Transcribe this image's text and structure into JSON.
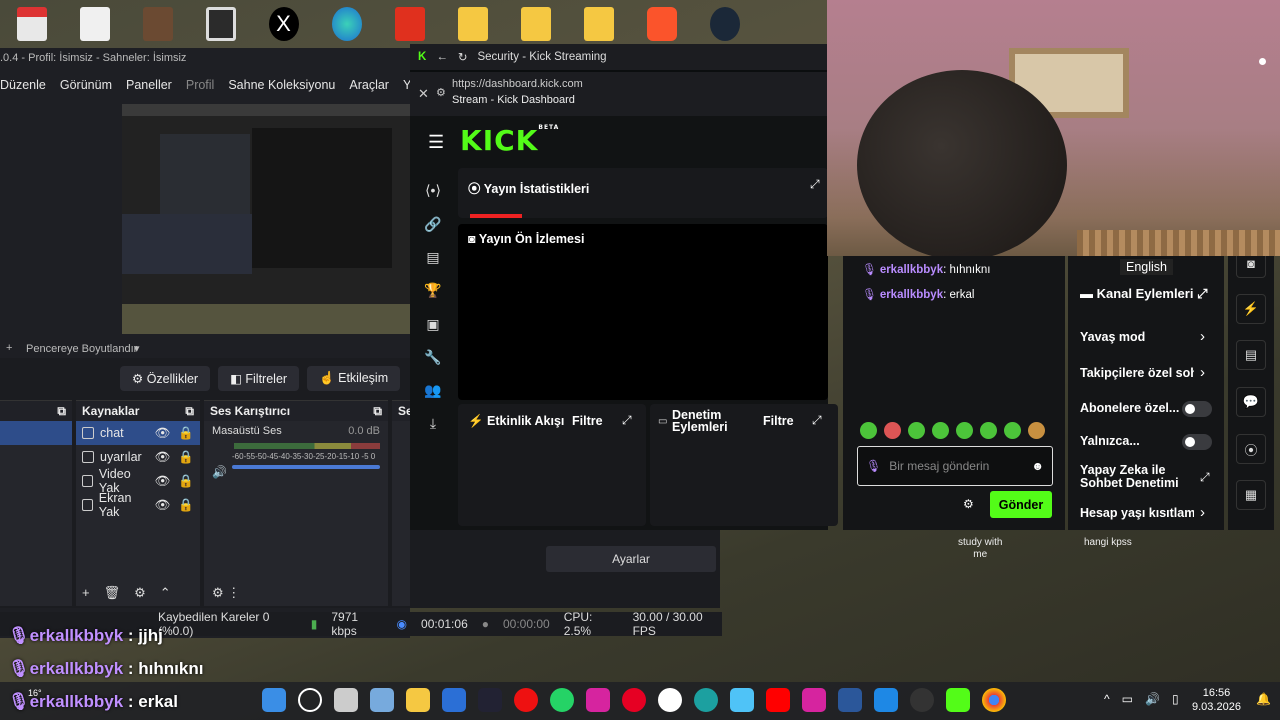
{
  "desktop": {
    "icons": [
      "pdf",
      "document",
      "folder-image",
      "folder-image",
      "x",
      "edge",
      "pdf-editor",
      "folder",
      "folder",
      "folder-pictures",
      "brave",
      "steam"
    ]
  },
  "obs": {
    "title": ".0.4 - Profil: İsimsiz - Sahneler: İsimsiz",
    "menu": [
      "Düzenle",
      "Görünüm",
      "Paneller",
      "Profil",
      "Sahne Koleksiyonu",
      "Araçlar",
      "Yardım"
    ],
    "window_size_label": "Pencereye Boyutlandır",
    "buttons": {
      "properties": "Özellikler",
      "filters": "Filtreler",
      "interact": "Etkileşim"
    },
    "sources_title": "Kaynaklar",
    "sources": [
      "chat",
      "uyarılar",
      "Video Yak",
      "Ekran Yak"
    ],
    "mixer_title": "Ses Karıştırıcı",
    "mixer_source": "Masaüstü Ses",
    "mixer_db": "0.0 dB",
    "mixer_scale": "-60-55-50-45-40-35-30-25-20-15-10 -5 0",
    "settings_button": "Ayarlar",
    "panel_s_label": "Se",
    "status": {
      "dropped": "Kaybedilen Kareler 0 (%0.0)",
      "bitrate": "7971 kbps",
      "live_time": "00:01:06",
      "rec_time": "00:00:00",
      "cpu": "CPU: 2.5%",
      "fps": "30.00 / 30.00 FPS"
    }
  },
  "browser": {
    "tab_title": "Security - Kick Streaming",
    "url": "https://dashboard.kick.com",
    "page_title": "Stream - Kick Dashboard",
    "logo": "KICK",
    "logo_badge": "BETA",
    "stats_title": "Yayın İstatistikleri",
    "preview_title": "Yayın Ön İzlemesi",
    "activity_title": "Etkinlik Akışı",
    "activity_filter": "Filtre",
    "moderation_title_1": "Denetim",
    "moderation_title_2": "Eylemleri",
    "moderation_filter": "Filtre"
  },
  "chat": {
    "messages": [
      {
        "user": "erkallkbbyk",
        "text": ": hıhnıknı"
      },
      {
        "user": "erkallkbbyk",
        "text": ": erkal"
      }
    ],
    "placeholder": "Bir mesaj gönderin",
    "send": "Gönder"
  },
  "channel_actions": {
    "language": "English",
    "title": "Kanal Eylemleri",
    "items": [
      "Yavaş mod",
      "Takipçilere özel sohb",
      "Abonelere özel...",
      "Yalnızca...",
      "Yapay Zeka ile",
      "Sohbet Denetimi",
      "Hesap yaşı kısıtlama"
    ]
  },
  "desktop_labels": {
    "study": "study with",
    "study2": "me",
    "kpss": "hangi kpss"
  },
  "overlay_chat": [
    {
      "user": "erkallkbbyk",
      "text": " : jjhj"
    },
    {
      "user": "erkallkbbyk",
      "text": " : hıhnıknı"
    },
    {
      "user": "erkallkbbyk",
      "text": " : erkal"
    }
  ],
  "taskbar": {
    "time": "16:56",
    "date": "9.03.2026",
    "weather": "16°"
  }
}
